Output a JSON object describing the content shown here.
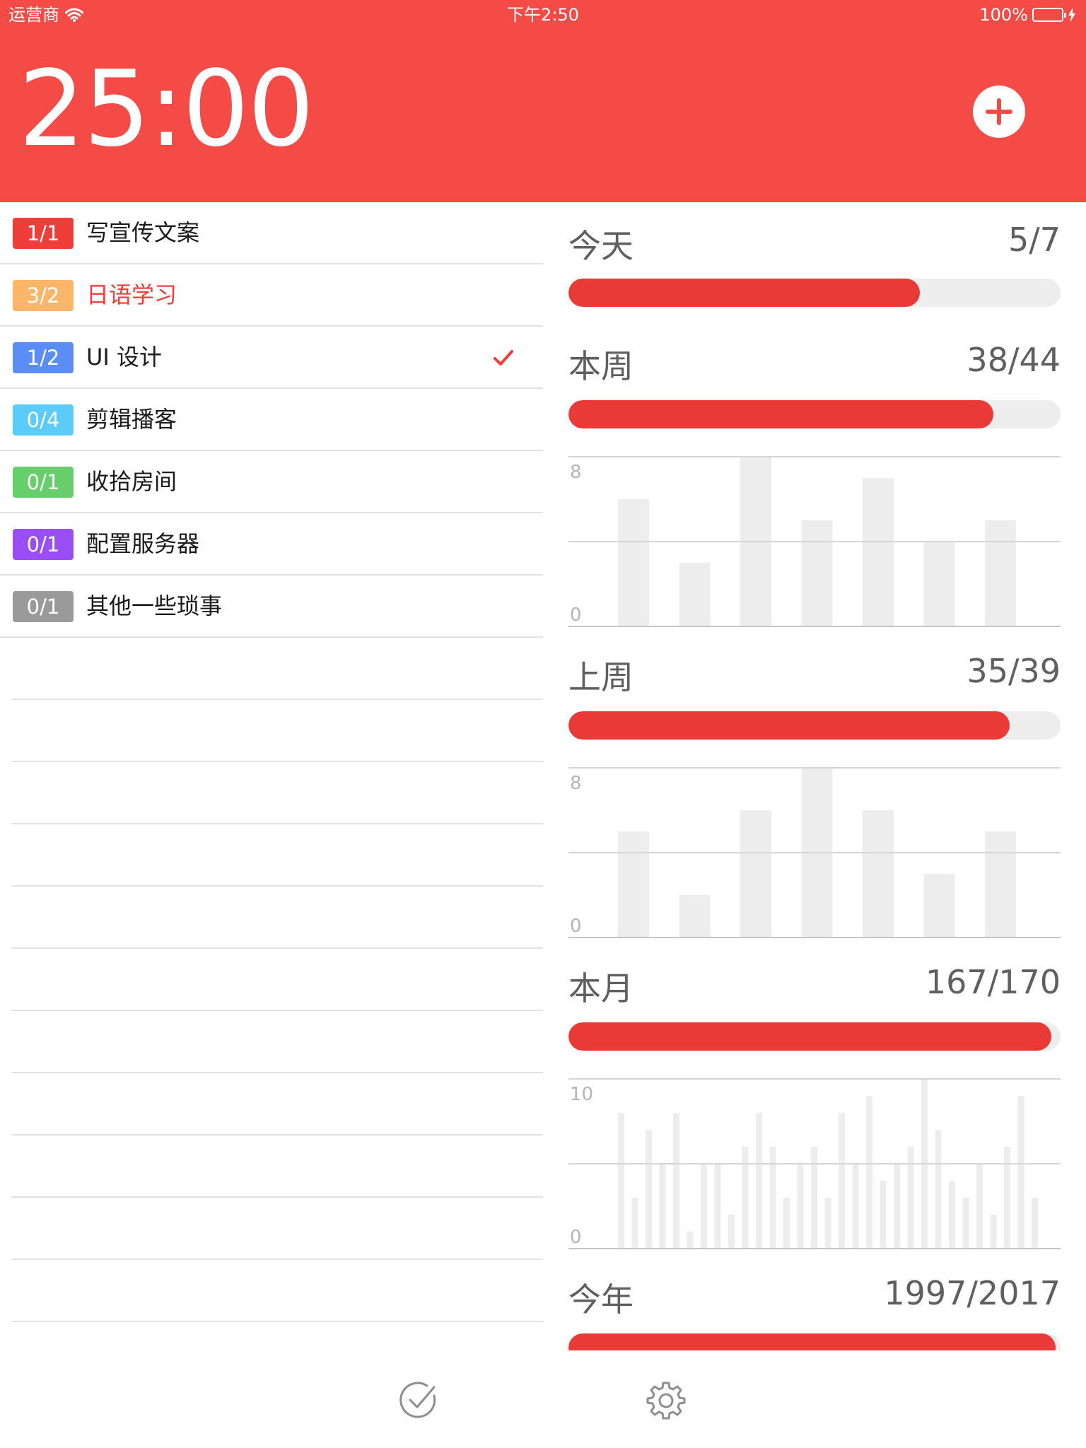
{
  "status_bar": {
    "carrier": "运营商",
    "time": "下午2:50",
    "battery": "100%"
  },
  "header": {
    "timer": "25:00",
    "add_icon": "plus-circle-icon"
  },
  "tasks": [
    {
      "badge": "1/1",
      "name": "写宣传文案",
      "color": "#EF3E3A",
      "name_color": "#1a1a1a",
      "checked": false
    },
    {
      "badge": "3/2",
      "name": "日语学习",
      "color": "#FDB56A",
      "name_color": "#EF3E3A",
      "checked": false
    },
    {
      "badge": "1/2",
      "name": "UI 设计",
      "color": "#5B8DF7",
      "name_color": "#1a1a1a",
      "checked": true
    },
    {
      "badge": "0/4",
      "name": "剪辑播客",
      "color": "#5BCBFA",
      "name_color": "#1a1a1a",
      "checked": false
    },
    {
      "badge": "0/1",
      "name": "收拾房间",
      "color": "#66CF6C",
      "name_color": "#1a1a1a",
      "checked": false
    },
    {
      "badge": "0/1",
      "name": "配置服务器",
      "color": "#9A4EF5",
      "name_color": "#1a1a1a",
      "checked": false
    },
    {
      "badge": "0/1",
      "name": "其他一些琐事",
      "color": "#9A9A9A",
      "name_color": "#1a1a1a",
      "checked": false
    }
  ],
  "stats": {
    "today": {
      "label": "今天",
      "value": "5/7",
      "progress": 0.714
    },
    "this_week": {
      "label": "本周",
      "value": "38/44",
      "progress": 0.864
    },
    "last_week": {
      "label": "上周",
      "value": "35/39",
      "progress": 0.897
    },
    "this_month": {
      "label": "本月",
      "value": "167/170",
      "progress": 0.982
    },
    "this_year": {
      "label": "今年",
      "value": "1997/2017",
      "progress": 0.99
    }
  },
  "chart_data": [
    {
      "type": "bar",
      "title": "本周",
      "ylim": [
        0,
        8
      ],
      "y_ticks": [
        "8",
        "0"
      ],
      "values": [
        6,
        3,
        8,
        5,
        7,
        4,
        5
      ]
    },
    {
      "type": "bar",
      "title": "上周",
      "ylim": [
        0,
        8
      ],
      "y_ticks": [
        "8",
        "0"
      ],
      "values": [
        5,
        2,
        6,
        8,
        6,
        3,
        5
      ]
    },
    {
      "type": "bar",
      "title": "本月",
      "ylim": [
        0,
        10
      ],
      "y_ticks": [
        "10",
        "0"
      ],
      "values": [
        8,
        3,
        7,
        5,
        8,
        1,
        5,
        5,
        2,
        6,
        8,
        6,
        3,
        5,
        6,
        3,
        8,
        5,
        9,
        4,
        5,
        6,
        10,
        7,
        4,
        3,
        5,
        2,
        6,
        9,
        3
      ]
    }
  ],
  "tabbar": {
    "tasks_icon": "check-circle-icon",
    "settings_icon": "gear-icon"
  },
  "colors": {
    "header": "#F44B47",
    "progress": "#E93A38",
    "track": "#EDEDED",
    "bar": "#EDEDED"
  }
}
